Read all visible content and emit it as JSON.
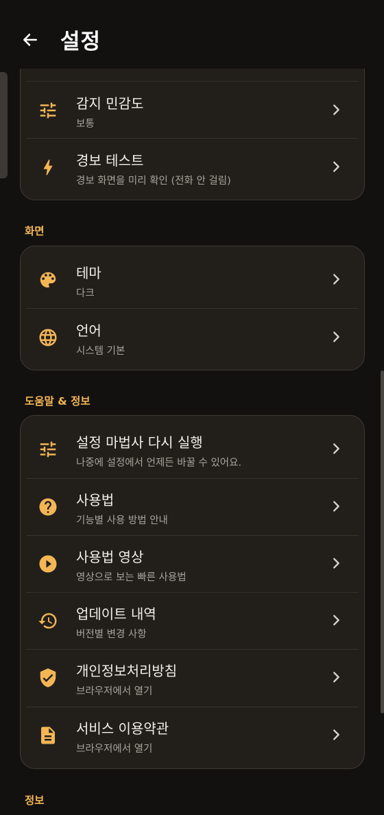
{
  "app_bar": {
    "title": "설정",
    "back_icon": "arrow-left-icon"
  },
  "theme": {
    "accent": "#f3b655",
    "background": "#121110",
    "card": "#221f1b"
  },
  "alerts_card": {
    "rows": [
      {
        "icon": "sliders-icon",
        "title": "감지 민감도",
        "subtitle": "보통"
      },
      {
        "icon": "lightning-icon",
        "title": "경보 테스트",
        "subtitle": "경보 화면을 미리 확인 (전화 안 걸림)"
      }
    ]
  },
  "display_section": {
    "header": "화면",
    "rows": [
      {
        "icon": "palette-icon",
        "title": "테마",
        "subtitle": "다크"
      },
      {
        "icon": "globe-icon",
        "title": "언어",
        "subtitle": "시스템 기본"
      }
    ]
  },
  "help_section": {
    "header": "도움말 & 정보",
    "rows": [
      {
        "icon": "sliders-icon",
        "title": "설정 마법사 다시 실행",
        "subtitle": "나중에 설정에서 언제든 바꿀 수 있어요."
      },
      {
        "icon": "help-circle-icon",
        "title": "사용법",
        "subtitle": "기능별 사용 방법 안내"
      },
      {
        "icon": "play-circle-icon",
        "title": "사용법 영상",
        "subtitle": "영상으로 보는 빠른 사용법"
      },
      {
        "icon": "history-icon",
        "title": "업데이트 내역",
        "subtitle": "버전별 변경 사항"
      },
      {
        "icon": "shield-check-icon",
        "title": "개인정보처리방침",
        "subtitle": "브라우저에서 열기"
      },
      {
        "icon": "document-icon",
        "title": "서비스 이용약관",
        "subtitle": "브라우저에서 열기"
      }
    ]
  },
  "info_section": {
    "header": "정보"
  }
}
